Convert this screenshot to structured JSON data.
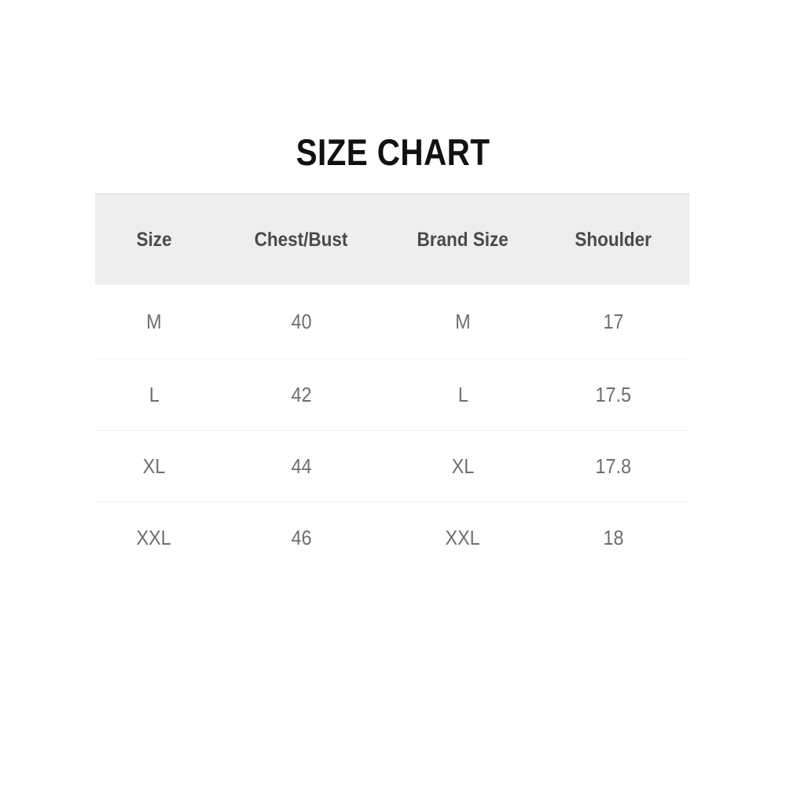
{
  "title": "SIZE CHART",
  "colors": {
    "page_background": "#ffffff",
    "header_background": "#efeeee",
    "header_top_border": "#e4e3e3",
    "row_separator": "#f3f3f3",
    "title_text": "#111111",
    "header_text": "#4a4a4a",
    "cell_text": "#6e6e6e"
  },
  "chart_data": {
    "type": "table",
    "title": "SIZE CHART",
    "columns": [
      "Size",
      "Chest/Bust",
      "Brand Size",
      "Shoulder"
    ],
    "rows": [
      {
        "size": "M",
        "chest_bust": "40",
        "brand_size": "M",
        "shoulder": "17"
      },
      {
        "size": "L",
        "chest_bust": "42",
        "brand_size": "L",
        "shoulder": "17.5"
      },
      {
        "size": "XL",
        "chest_bust": "44",
        "brand_size": "XL",
        "shoulder": "17.8"
      },
      {
        "size": "XXL",
        "chest_bust": "46",
        "brand_size": "XXL",
        "shoulder": "18"
      }
    ],
    "cells": [
      [
        "M",
        "40",
        "M",
        "17"
      ],
      [
        "L",
        "42",
        "L",
        "17.5"
      ],
      [
        "XL",
        "44",
        "XL",
        "17.8"
      ],
      [
        "XXL",
        "46",
        "XXL",
        "18"
      ]
    ]
  }
}
